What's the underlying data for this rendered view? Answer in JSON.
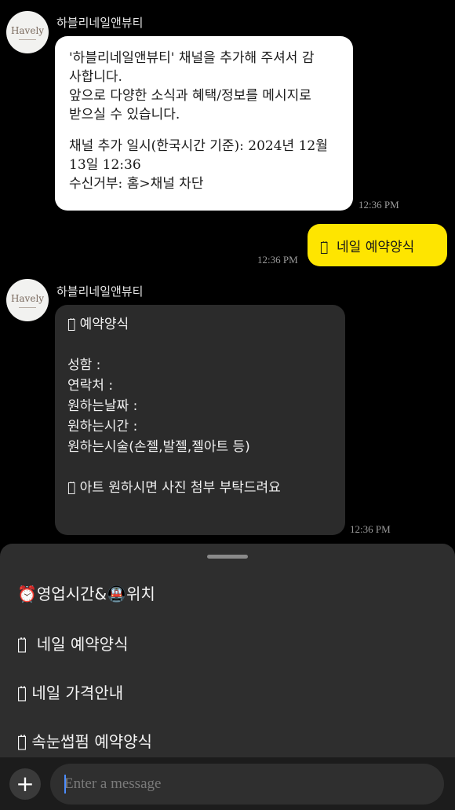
{
  "channel": {
    "name": "하블리네일앤뷰티",
    "logo_text": "Havely"
  },
  "messages": [
    {
      "type": "received",
      "lines": [
        "'하블리네일앤뷰티' 채널을 추가해 주셔서 감",
        "사합니다.",
        "앞으로 다양한 소식과 혜택/정보를 메시지로",
        "받으실 수 있습니다.",
        "",
        "채널 추가 일시(한국시간 기준): 2024년 12월",
        "13일 12:36",
        "수신거부: 홈>채널 차단"
      ],
      "time": "12:36 PM"
    },
    {
      "type": "sent",
      "text": "ᅟ̈  네일 예약양식",
      "time": "12:36 PM"
    },
    {
      "type": "received",
      "lines": [
        "ᅟ̈ 예약양식",
        "",
        "성함 :",
        "연락처 :",
        "원하는날짜 :",
        "원하는시간 :",
        "원하는시술(손젤,발젤,젤아트 등)",
        "",
        "ᅟ̈ 아트 원하시면 사진 첨부 부탁드려요"
      ],
      "time": "12:36 PM"
    }
  ],
  "quick_menu": {
    "items": [
      {
        "label": "⏰영업시간&🚇위치"
      },
      {
        "label": "ᅟ̈  네일 예약양식"
      },
      {
        "label": "ᅟ̈ 네일 가격안내"
      },
      {
        "label": "ᅟ̈ 속눈썹펌 예약양식"
      }
    ]
  },
  "input": {
    "placeholder": "Enter a message"
  },
  "icons": {
    "add": "plus-icon"
  },
  "colors": {
    "sent_bubble": "#fee500",
    "background": "#000000",
    "received_dark": "#2b2b2b"
  }
}
